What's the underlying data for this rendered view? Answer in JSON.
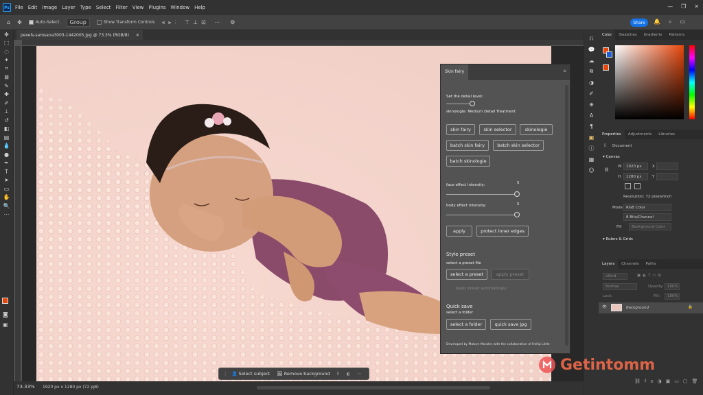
{
  "app": {
    "logo": "Ps"
  },
  "menu": [
    "File",
    "Edit",
    "Image",
    "Layer",
    "Type",
    "Select",
    "Filter",
    "View",
    "Plugins",
    "Window",
    "Help"
  ],
  "options": {
    "auto_select": "Auto-Select",
    "group": "Group",
    "show_transform": "Show Transform Controls",
    "share": "Share"
  },
  "document": {
    "tab_title": "pexels-samsana3003-1442005.jpg @ 73.3% (RGB/8)",
    "zoom": "73.33%",
    "size_info": "1920 px x 1280 px (72 ppi)"
  },
  "context_bar": {
    "select_subject": "Select subject",
    "remove_background": "Remove background"
  },
  "plugin": {
    "tab": "Skin fairy",
    "detail_label": "Set the detail level:",
    "detail_value": "skinologie: Medium Detail Treatment",
    "buttons_row1": [
      "skin fairy",
      "skin selector",
      "skinologie"
    ],
    "buttons_row2": [
      "batch skin fairy",
      "batch skin selector"
    ],
    "buttons_row3": [
      "batch skinologie"
    ],
    "face_label": "face effect intensity:",
    "face_value": "5",
    "body_label": "body effect intensity:",
    "body_value": "5",
    "apply": "apply",
    "protect": "protect inner edges",
    "style_preset": "Style preset",
    "select_preset_file": "select a preset file",
    "select_preset": "select a preset",
    "apply_preset": "apply preset",
    "apply_auto": "Apply preset automatically",
    "quick_save": "Quick save",
    "select_folder_label": "select a folder",
    "select_folder": "select a folder",
    "quick_save_jpg": "quick save jpg",
    "footer": "Developed by Mature Morales with the collaboration of Hellip Little"
  },
  "color_panel": {
    "tabs": [
      "Color",
      "Swatches",
      "Gradients",
      "Patterns"
    ],
    "fg": "#e8470c",
    "bg": "#1f5fd6"
  },
  "properties": {
    "tabs": [
      "Properties",
      "Adjustments",
      "Libraries"
    ],
    "document": "Document",
    "canvas": "Canvas",
    "w_label": "W",
    "w_value": "1920 px",
    "h_label": "H",
    "h_value": "1280 px",
    "x_label": "X",
    "y_label": "Y",
    "resolution": "Resolution: 72 pixels/inch",
    "mode_label": "Mode",
    "mode": "RGB Color",
    "depth": "8 Bits/Channel",
    "fill_label": "Fill",
    "fill": "Background Color",
    "rulers": "Rulers & Grids"
  },
  "layers": {
    "tabs": [
      "Layers",
      "Channels",
      "Paths"
    ],
    "search": "Kind",
    "blend": "Normal",
    "opacity_label": "Opacity:",
    "opacity": "100%",
    "lock_label": "Lock:",
    "fill_label": "Fill:",
    "fill": "100%",
    "layer_name": "Background"
  },
  "watermark": "Getintomm"
}
